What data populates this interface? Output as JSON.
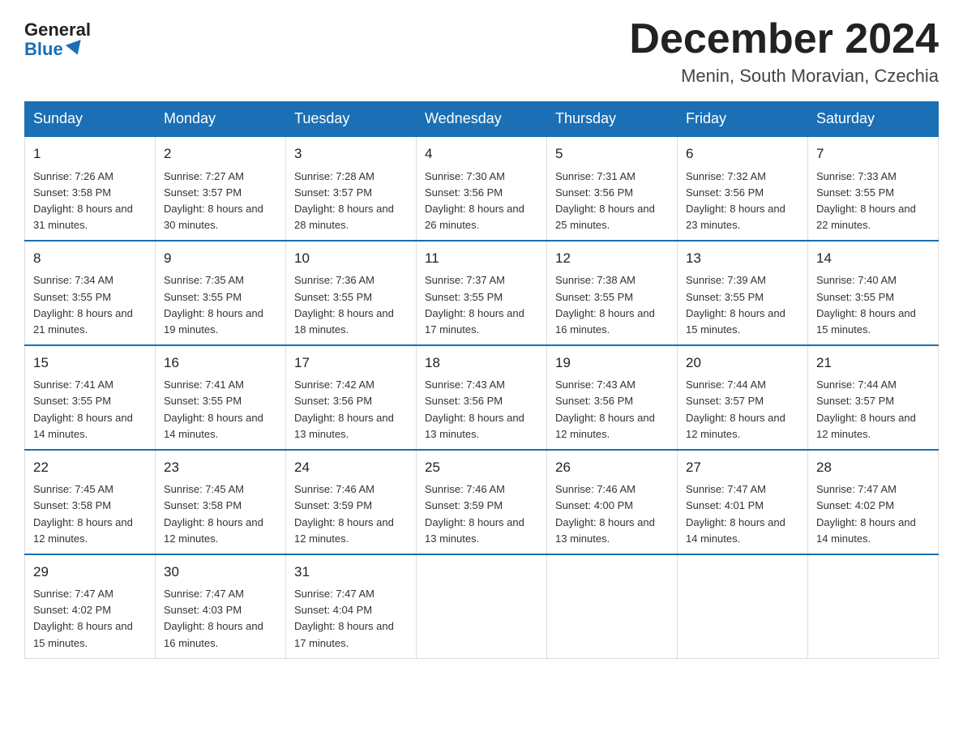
{
  "logo": {
    "general": "General",
    "blue": "Blue"
  },
  "title": "December 2024",
  "location": "Menin, South Moravian, Czechia",
  "days_of_week": [
    "Sunday",
    "Monday",
    "Tuesday",
    "Wednesday",
    "Thursday",
    "Friday",
    "Saturday"
  ],
  "weeks": [
    [
      {
        "day": "1",
        "sunrise": "7:26 AM",
        "sunset": "3:58 PM",
        "daylight": "8 hours and 31 minutes."
      },
      {
        "day": "2",
        "sunrise": "7:27 AM",
        "sunset": "3:57 PM",
        "daylight": "8 hours and 30 minutes."
      },
      {
        "day": "3",
        "sunrise": "7:28 AM",
        "sunset": "3:57 PM",
        "daylight": "8 hours and 28 minutes."
      },
      {
        "day": "4",
        "sunrise": "7:30 AM",
        "sunset": "3:56 PM",
        "daylight": "8 hours and 26 minutes."
      },
      {
        "day": "5",
        "sunrise": "7:31 AM",
        "sunset": "3:56 PM",
        "daylight": "8 hours and 25 minutes."
      },
      {
        "day": "6",
        "sunrise": "7:32 AM",
        "sunset": "3:56 PM",
        "daylight": "8 hours and 23 minutes."
      },
      {
        "day": "7",
        "sunrise": "7:33 AM",
        "sunset": "3:55 PM",
        "daylight": "8 hours and 22 minutes."
      }
    ],
    [
      {
        "day": "8",
        "sunrise": "7:34 AM",
        "sunset": "3:55 PM",
        "daylight": "8 hours and 21 minutes."
      },
      {
        "day": "9",
        "sunrise": "7:35 AM",
        "sunset": "3:55 PM",
        "daylight": "8 hours and 19 minutes."
      },
      {
        "day": "10",
        "sunrise": "7:36 AM",
        "sunset": "3:55 PM",
        "daylight": "8 hours and 18 minutes."
      },
      {
        "day": "11",
        "sunrise": "7:37 AM",
        "sunset": "3:55 PM",
        "daylight": "8 hours and 17 minutes."
      },
      {
        "day": "12",
        "sunrise": "7:38 AM",
        "sunset": "3:55 PM",
        "daylight": "8 hours and 16 minutes."
      },
      {
        "day": "13",
        "sunrise": "7:39 AM",
        "sunset": "3:55 PM",
        "daylight": "8 hours and 15 minutes."
      },
      {
        "day": "14",
        "sunrise": "7:40 AM",
        "sunset": "3:55 PM",
        "daylight": "8 hours and 15 minutes."
      }
    ],
    [
      {
        "day": "15",
        "sunrise": "7:41 AM",
        "sunset": "3:55 PM",
        "daylight": "8 hours and 14 minutes."
      },
      {
        "day": "16",
        "sunrise": "7:41 AM",
        "sunset": "3:55 PM",
        "daylight": "8 hours and 14 minutes."
      },
      {
        "day": "17",
        "sunrise": "7:42 AM",
        "sunset": "3:56 PM",
        "daylight": "8 hours and 13 minutes."
      },
      {
        "day": "18",
        "sunrise": "7:43 AM",
        "sunset": "3:56 PM",
        "daylight": "8 hours and 13 minutes."
      },
      {
        "day": "19",
        "sunrise": "7:43 AM",
        "sunset": "3:56 PM",
        "daylight": "8 hours and 12 minutes."
      },
      {
        "day": "20",
        "sunrise": "7:44 AM",
        "sunset": "3:57 PM",
        "daylight": "8 hours and 12 minutes."
      },
      {
        "day": "21",
        "sunrise": "7:44 AM",
        "sunset": "3:57 PM",
        "daylight": "8 hours and 12 minutes."
      }
    ],
    [
      {
        "day": "22",
        "sunrise": "7:45 AM",
        "sunset": "3:58 PM",
        "daylight": "8 hours and 12 minutes."
      },
      {
        "day": "23",
        "sunrise": "7:45 AM",
        "sunset": "3:58 PM",
        "daylight": "8 hours and 12 minutes."
      },
      {
        "day": "24",
        "sunrise": "7:46 AM",
        "sunset": "3:59 PM",
        "daylight": "8 hours and 12 minutes."
      },
      {
        "day": "25",
        "sunrise": "7:46 AM",
        "sunset": "3:59 PM",
        "daylight": "8 hours and 13 minutes."
      },
      {
        "day": "26",
        "sunrise": "7:46 AM",
        "sunset": "4:00 PM",
        "daylight": "8 hours and 13 minutes."
      },
      {
        "day": "27",
        "sunrise": "7:47 AM",
        "sunset": "4:01 PM",
        "daylight": "8 hours and 14 minutes."
      },
      {
        "day": "28",
        "sunrise": "7:47 AM",
        "sunset": "4:02 PM",
        "daylight": "8 hours and 14 minutes."
      }
    ],
    [
      {
        "day": "29",
        "sunrise": "7:47 AM",
        "sunset": "4:02 PM",
        "daylight": "8 hours and 15 minutes."
      },
      {
        "day": "30",
        "sunrise": "7:47 AM",
        "sunset": "4:03 PM",
        "daylight": "8 hours and 16 minutes."
      },
      {
        "day": "31",
        "sunrise": "7:47 AM",
        "sunset": "4:04 PM",
        "daylight": "8 hours and 17 minutes."
      },
      {
        "day": "",
        "sunrise": "",
        "sunset": "",
        "daylight": ""
      },
      {
        "day": "",
        "sunrise": "",
        "sunset": "",
        "daylight": ""
      },
      {
        "day": "",
        "sunrise": "",
        "sunset": "",
        "daylight": ""
      },
      {
        "day": "",
        "sunrise": "",
        "sunset": "",
        "daylight": ""
      }
    ]
  ]
}
